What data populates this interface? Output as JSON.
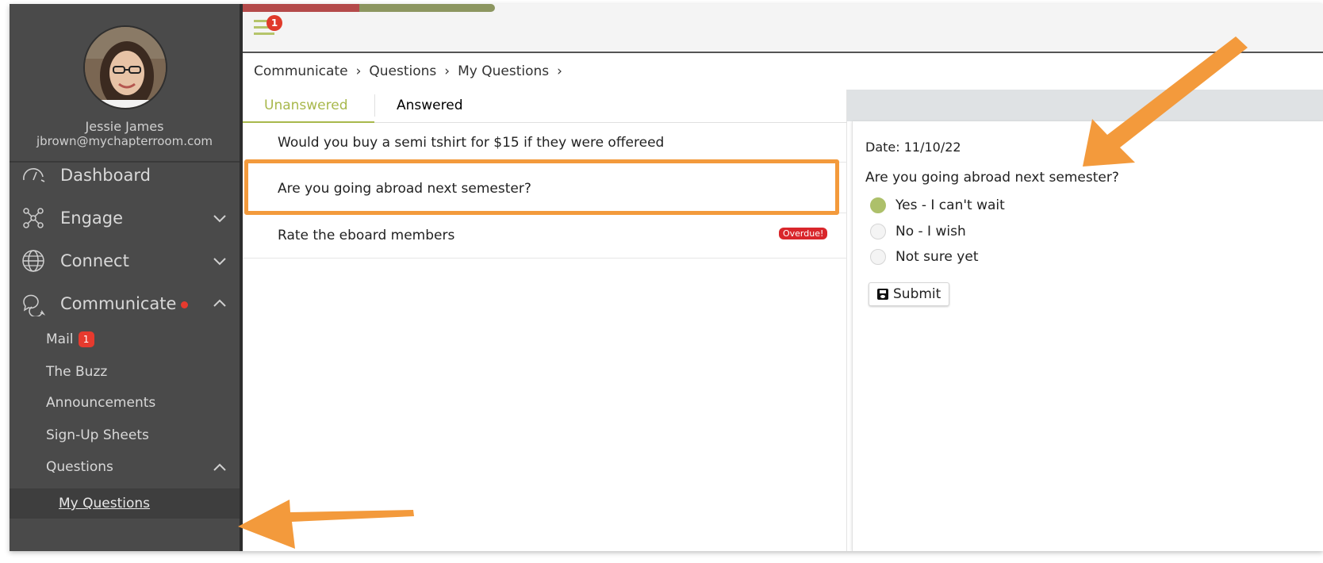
{
  "profile": {
    "name": "Jessie James",
    "email": "jbrown@mychapterroom.com"
  },
  "sidebar": {
    "items": [
      {
        "label": "Dashboard",
        "icon": "gauge-icon"
      },
      {
        "label": "Engage",
        "icon": "network-icon"
      },
      {
        "label": "Connect",
        "icon": "globe-icon"
      },
      {
        "label": "Communicate",
        "icon": "chat-bubbles-icon"
      }
    ],
    "communicate_sub": [
      {
        "label": "Mail",
        "badge": "1"
      },
      {
        "label": "The Buzz"
      },
      {
        "label": "Announcements"
      },
      {
        "label": "Sign-Up Sheets"
      },
      {
        "label": "Questions"
      }
    ],
    "questions_sub": {
      "label": "My Questions"
    }
  },
  "topbar": {
    "menu_badge": "1"
  },
  "breadcrumb": {
    "items": [
      "Communicate",
      "Questions",
      "My Questions"
    ]
  },
  "tabs": {
    "unanswered": "Unanswered",
    "answered": "Answered"
  },
  "questions": [
    {
      "text": "Would you buy a semi tshirt for $15 if they were offereed"
    },
    {
      "text": "Are you going abroad next semester?"
    },
    {
      "text": "Rate the eboard members",
      "badge": "Overdue!"
    }
  ],
  "detail": {
    "date": "Date: 11/10/22",
    "question": "Are you going abroad next semester?",
    "options": [
      "Yes - I can't wait",
      "No - I wish",
      "Not sure yet"
    ],
    "selected_option": "Yes - I can't wait",
    "submit_label": "Submit"
  },
  "colors": {
    "accent": "#a8b84c",
    "highlight": "#f39a3c",
    "badge": "#d9262b",
    "sidebar": "#4a4a4a"
  }
}
